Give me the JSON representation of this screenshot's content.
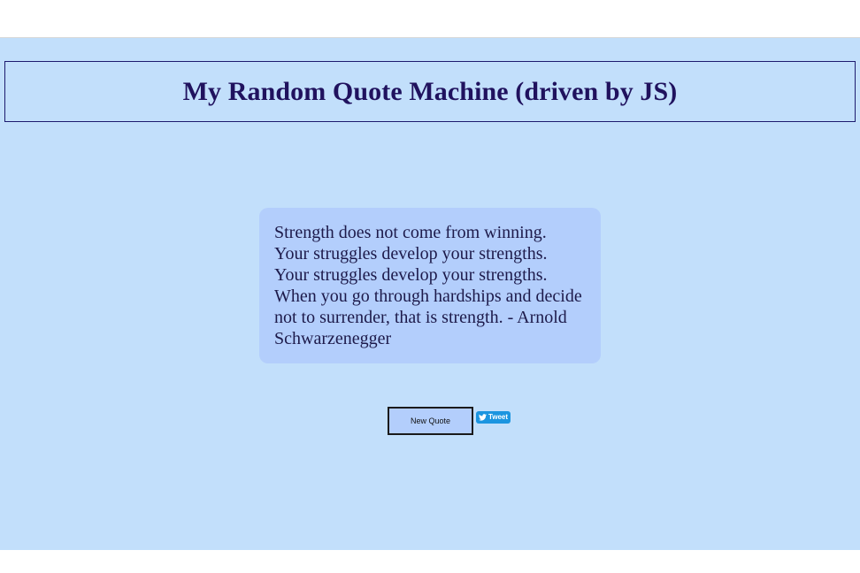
{
  "header": {
    "title": "My Random Quote Machine (driven by JS)"
  },
  "quote": {
    "text": "Strength does not come from winning. Your struggles develop your strengths. Your struggles develop your strengths. When you go through hardships and decide not to surrender, that is strength. - Arnold Schwarzenegger"
  },
  "actions": {
    "new_quote_label": "New Quote",
    "tweet_label": "Tweet",
    "tweet_icon": "twitter-bird-icon"
  },
  "colors": {
    "background": "#c2dffb",
    "quote_box": "#b3cefc",
    "title_text": "#20125e",
    "tweet_button": "#1b95e0"
  }
}
